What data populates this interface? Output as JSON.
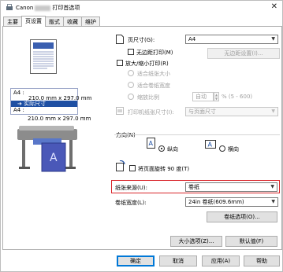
{
  "title": {
    "brand": "Canon",
    "suffix": "打印首选项"
  },
  "tabs": [
    "主要",
    "页设置",
    "版式",
    "收藏",
    "维护"
  ],
  "active_tab": 1,
  "preview": {
    "size_line1": "A4 :",
    "size_line2": "210.0 mm x 297.0 mm",
    "actual_size": "实际尺寸",
    "size_line3": "A4 :",
    "size_line4": "210.0 mm x 297.0 mm"
  },
  "page_size": {
    "label": "页尺寸(G):",
    "value": "A4"
  },
  "borderless": {
    "label": "无边距打印(M)",
    "settings_button": "无边距设置(I)..."
  },
  "scaled": {
    "label": "放大/缩小打印(R)"
  },
  "fit_paper": {
    "label": "适合纸张大小"
  },
  "fit_roll": {
    "label": "适合卷纸宽度"
  },
  "scaling": {
    "label": "缩放比例",
    "value": "自动",
    "unit": "% (5 - 600)"
  },
  "output_size": {
    "label": "打印机纸张尺寸(I):",
    "value": "与页面尺寸"
  },
  "orientation": {
    "group_label": "方向(N)",
    "portrait": "纵向",
    "landscape": "横向"
  },
  "rotate": {
    "label": "将页面旋转 90 度(T)"
  },
  "paper_source": {
    "label": "纸张来源(U):",
    "value": "卷纸"
  },
  "roll_width": {
    "label": "卷纸宽度(L):",
    "value": "24in 卷纸(609.6mm)"
  },
  "roll_options_button": "卷纸选项(O)...",
  "size_options_button": "大小选项(Z)...",
  "defaults_button": "默认值(F)",
  "footer": {
    "ok": "确定",
    "cancel": "取消",
    "apply": "应用(A)",
    "help": "帮助"
  },
  "colors": {
    "highlight": "#d9262b",
    "selection": "#1e4fa3"
  },
  "icons": [
    "close-icon",
    "canon-printer-icon",
    "page-preview-icon",
    "printer-illustration-icon",
    "portrait-icon",
    "landscape-icon",
    "rotate-page-icon",
    "output-size-icon",
    "chevron-down-icon"
  ]
}
